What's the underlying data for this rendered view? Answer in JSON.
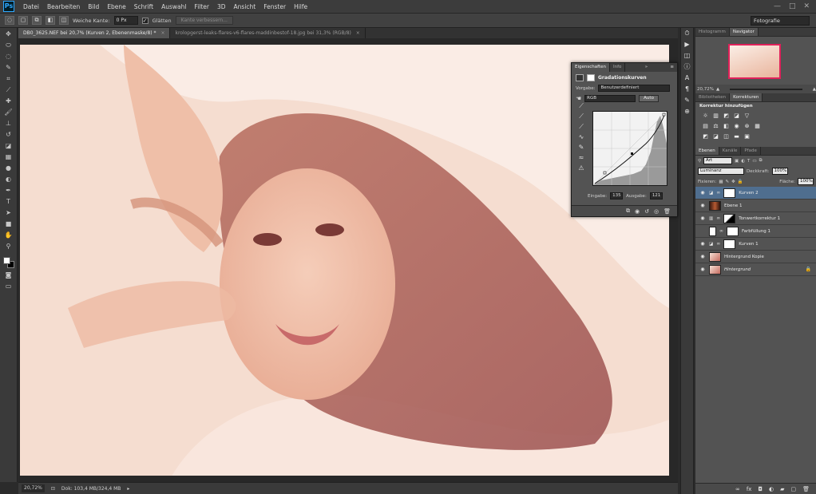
{
  "app": {
    "logo": "Ps"
  },
  "menu": [
    "Datei",
    "Bearbeiten",
    "Bild",
    "Ebene",
    "Schrift",
    "Auswahl",
    "Filter",
    "3D",
    "Ansicht",
    "Fenster",
    "Hilfe"
  ],
  "window_controls": {
    "minimize": "—",
    "maximize": "□",
    "close": "✕"
  },
  "options": {
    "feather_label": "Weiche Kante:",
    "feather_value": "0 Px",
    "antialias_label": "Glätten",
    "antialias_checked": "✓",
    "refine_edge_label": "Kante verbessern...",
    "workspace": "Fotografie"
  },
  "tabs": [
    {
      "label": "DB0_3625.NEF bei 20,7% (Kurven 2, Ebenenmaske/8) *",
      "close": "×"
    },
    {
      "label": "krolopgerst-leaks-flares-v6-flares-maddinbestof-18.jpg bei 31,3% (RGB/8)",
      "close": "×"
    }
  ],
  "status": {
    "zoom": "20,72%",
    "doc": "Dok: 103,4 MB/324,4 MB",
    "arrow": "▸"
  },
  "properties": {
    "tab_props": "Eigenschaften",
    "tab_info": "Info",
    "menu_icon": "≡",
    "collapse_icon": "»",
    "title": "Gradationskurven",
    "preset_label": "Vorgabe:",
    "preset_value": "Benutzerdefiniert",
    "channel_value": "RGB",
    "auto_label": "Auto",
    "input_label": "Eingabe:",
    "input_value": "135",
    "output_label": "Ausgabe:",
    "output_value": "121"
  },
  "navigator": {
    "tab_histogram": "Histogramm",
    "tab_navigator": "Navigator",
    "zoom": "20,72%"
  },
  "adjustments": {
    "tab_libraries": "Bibliotheken",
    "tab_corrections": "Korrekturen",
    "title": "Korrektur hinzufügen"
  },
  "layers_panel": {
    "tab_layers": "Ebenen",
    "tab_channels": "Kanäle",
    "tab_paths": "Pfade",
    "filter_kind": "Art",
    "blend_mode": "Luminanz",
    "opacity_label": "Deckkraft:",
    "opacity_value": "100%",
    "lock_label": "Fixieren:",
    "fill_label": "Fläche:",
    "fill_value": "100%",
    "layers": [
      {
        "name": "Kurven 2"
      },
      {
        "name": "Ebene 1"
      },
      {
        "name": "Tonwertkorrektur 1"
      },
      {
        "name": "Farbfüllung 1"
      },
      {
        "name": "Kurven 1"
      },
      {
        "name": "Hintergrund Kopie"
      },
      {
        "name": "Hintergrund"
      }
    ]
  },
  "icons": {
    "tools": [
      "move-tool",
      "marquee-tool",
      "lasso-tool",
      "quick-select-tool",
      "crop-tool",
      "eyedropper-tool",
      "healing-tool",
      "brush-tool",
      "stamp-tool",
      "history-brush-tool",
      "eraser-tool",
      "gradient-tool",
      "blur-tool",
      "dodge-tool",
      "pen-tool",
      "type-tool",
      "path-select-tool",
      "shape-tool",
      "hand-tool",
      "zoom-tool"
    ]
  },
  "colors": {
    "accent": "#4f6e8f",
    "navigator_frame": "#e0215a",
    "photo_tint": "#f2c9b4"
  }
}
